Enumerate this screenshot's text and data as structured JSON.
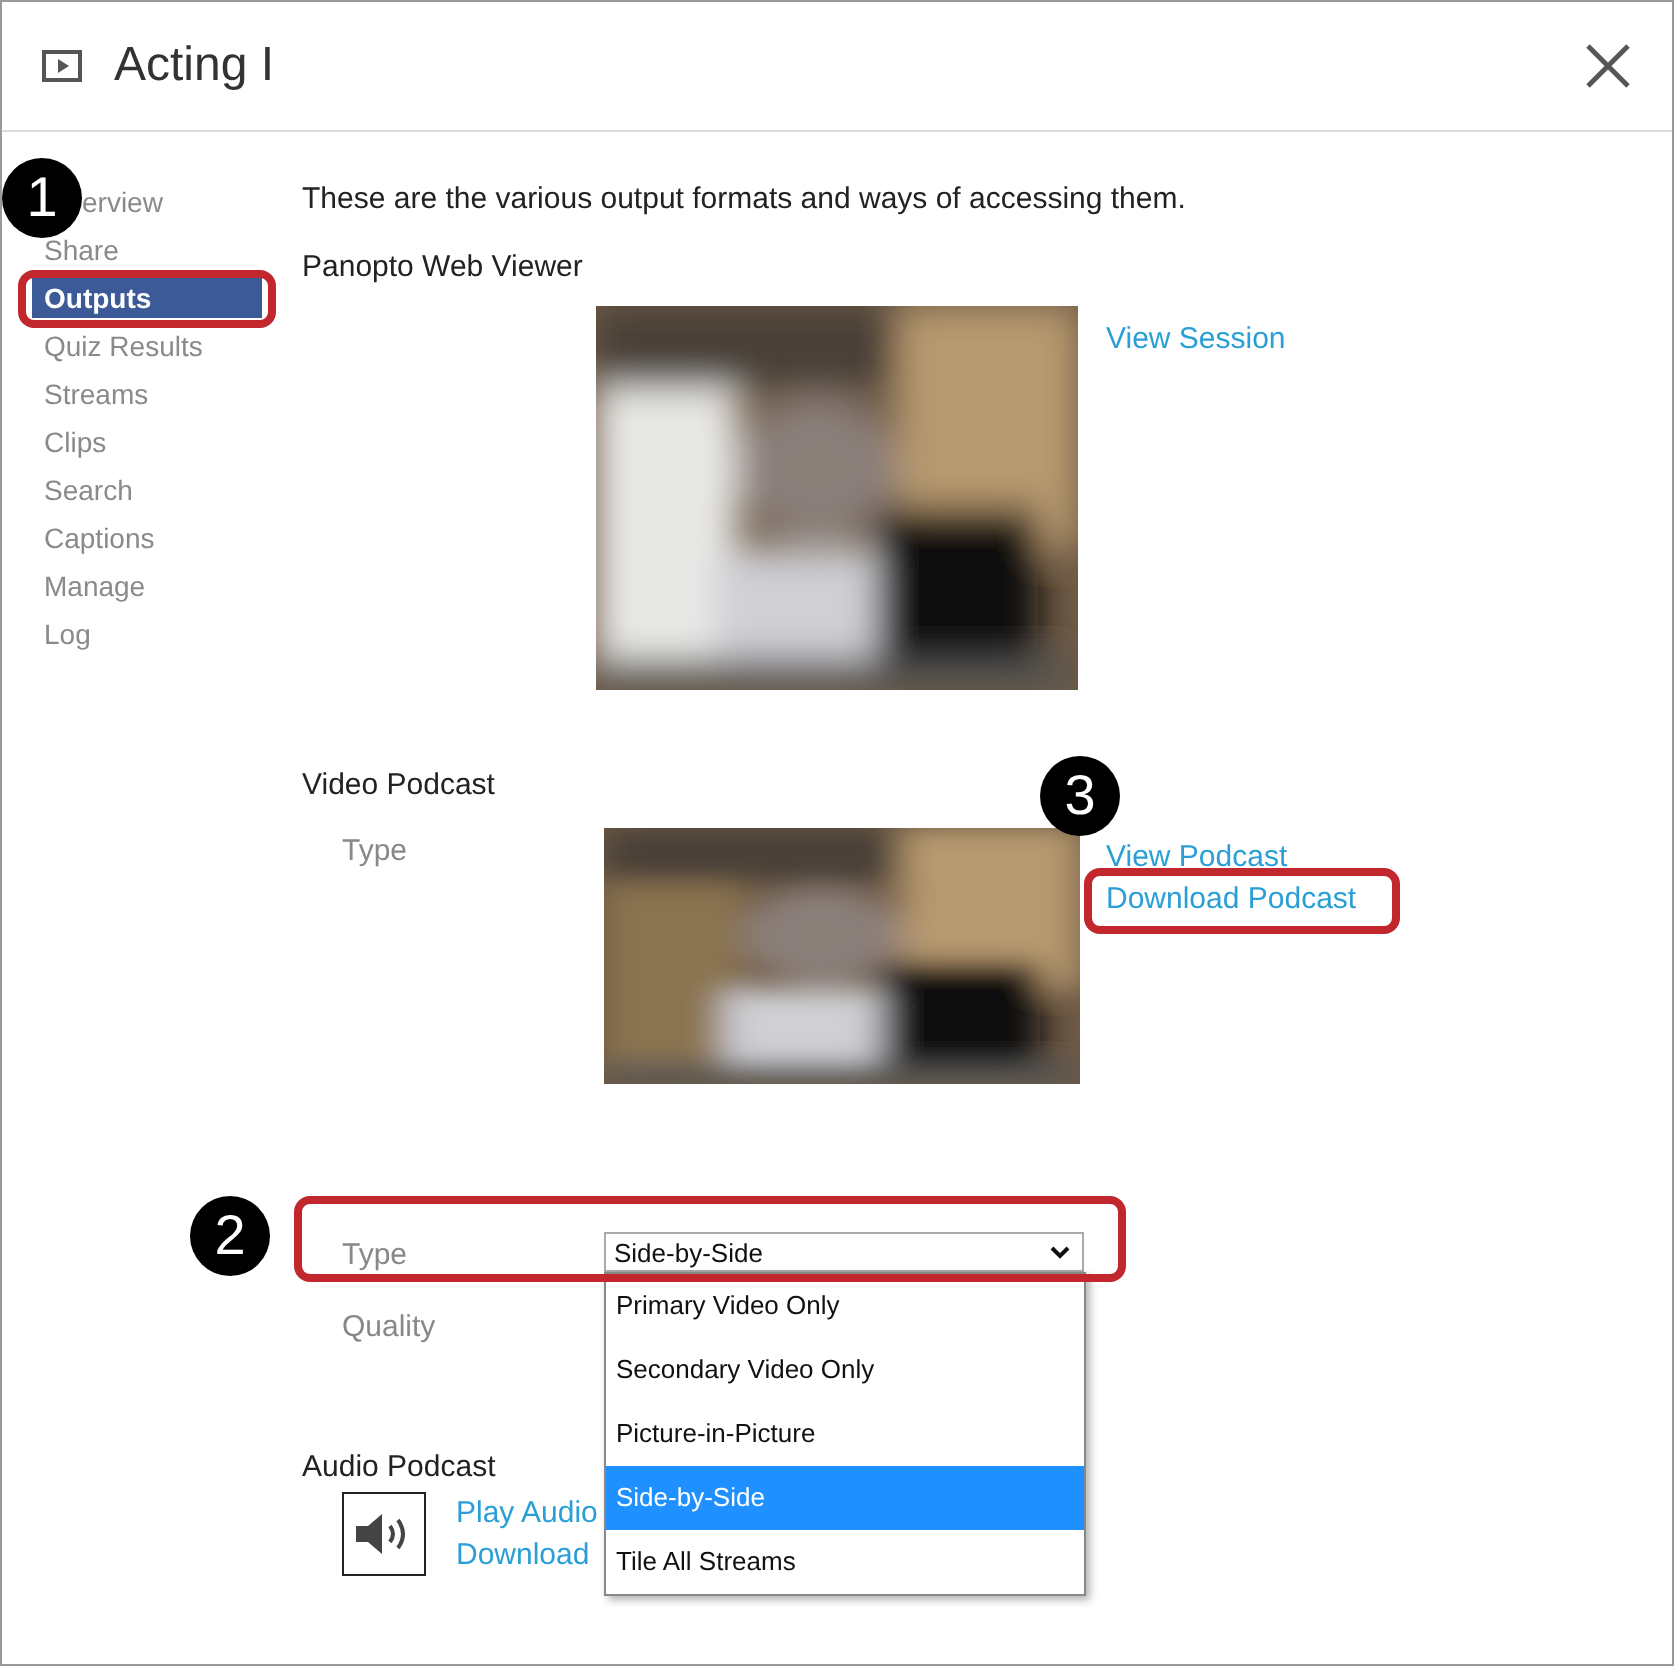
{
  "window": {
    "title": "Acting I"
  },
  "sidebar": {
    "items": [
      {
        "label": "erview",
        "selected": false
      },
      {
        "label": "Share",
        "selected": false
      },
      {
        "label": "Outputs",
        "selected": true
      },
      {
        "label": "Quiz Results",
        "selected": false
      },
      {
        "label": "Streams",
        "selected": false
      },
      {
        "label": "Clips",
        "selected": false
      },
      {
        "label": "Search",
        "selected": false
      },
      {
        "label": "Captions",
        "selected": false
      },
      {
        "label": "Manage",
        "selected": false
      },
      {
        "label": "Log",
        "selected": false
      }
    ]
  },
  "content": {
    "intro": "These are the various output formats and ways of accessing them.",
    "web_viewer": {
      "heading": "Panopto Web Viewer",
      "links": [
        "View Session"
      ]
    },
    "video_podcast": {
      "heading": "Video Podcast",
      "type_label": "Type",
      "links": [
        "View Podcast",
        "Download Podcast"
      ]
    },
    "settings": {
      "type_label": "Type",
      "type_value": "Side-by-Side",
      "quality_label": "Quality",
      "options": [
        {
          "label": "Primary Video Only",
          "selected": false
        },
        {
          "label": "Secondary Video Only",
          "selected": false
        },
        {
          "label": "Picture-in-Picture",
          "selected": false
        },
        {
          "label": "Side-by-Side",
          "selected": true
        },
        {
          "label": "Tile All Streams",
          "selected": false
        }
      ]
    },
    "audio_podcast": {
      "heading": "Audio Podcast",
      "links": [
        "Play Audio",
        "Download"
      ]
    }
  },
  "annotations": [
    {
      "number": "1"
    },
    {
      "number": "2"
    },
    {
      "number": "3"
    }
  ]
}
